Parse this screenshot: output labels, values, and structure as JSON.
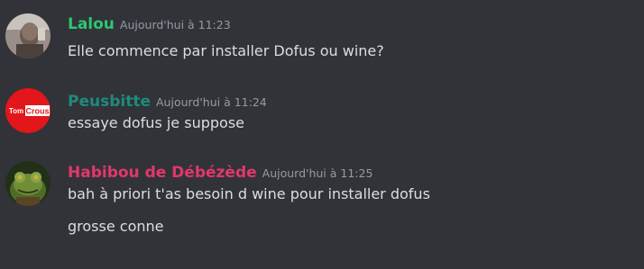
{
  "messages": [
    {
      "author": "Lalou",
      "author_color": "#2dc770",
      "timestamp": "Aujourd'hui à 11:23",
      "lines": [
        "Elle commence par installer Dofus ou wine?"
      ]
    },
    {
      "author": "Peusbitte",
      "author_color": "#1f8b7c",
      "timestamp": "Aujourd'hui à 11:24",
      "avatar_text_left": "Tom",
      "avatar_text_right": "Crous",
      "lines": [
        "essaye dofus je suppose"
      ]
    },
    {
      "author": "Habibou de Débézède",
      "author_color": "#e0386a",
      "timestamp": "Aujourd'hui à 11:25",
      "lines": [
        "bah à priori t'as besoin d wine pour installer dofus",
        "grosse conne"
      ]
    }
  ]
}
